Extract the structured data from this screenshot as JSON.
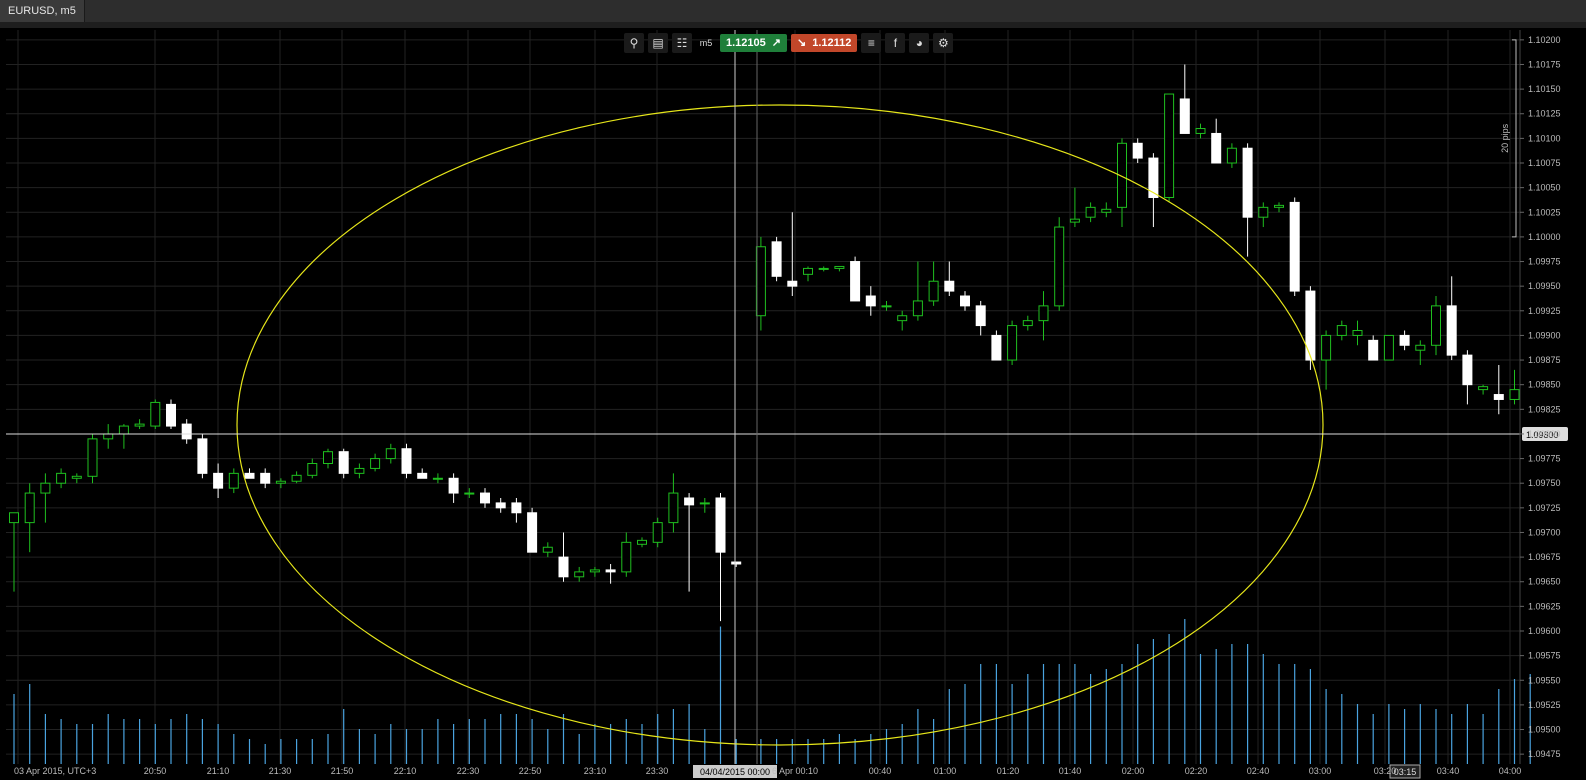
{
  "window": {
    "tab_label": "EURUSD, m5"
  },
  "toolbar": {
    "icons": [
      "search-icon",
      "chart-settings-icon",
      "candles-icon"
    ],
    "timeframe": "m5",
    "buy_price": "1.12105",
    "sell_price": "1.12112",
    "right_icons": [
      "list-icon",
      "facebook-icon",
      "share-icon",
      "tools-icon"
    ]
  },
  "colors": {
    "up_candle": "#1fbf1f",
    "down_candle": "#ffffff",
    "volume": "#4aa3df",
    "ellipse": "#e6e61a",
    "grid": "#222222",
    "background": "#000000"
  },
  "chart_data": {
    "type": "candlestick",
    "symbol": "EURUSD",
    "timeframe": "m5",
    "y_ticks": [
      "1.10200",
      "1.10175",
      "1.10150",
      "1.10125",
      "1.10100",
      "1.10075",
      "1.10050",
      "1.10025",
      "1.10000",
      "1.09975",
      "1.09950",
      "1.09925",
      "1.09900",
      "1.09875",
      "1.09850",
      "1.09825",
      "1.09800",
      "1.09775",
      "1.09750",
      "1.09725",
      "1.09700",
      "1.09675",
      "1.09650",
      "1.09625",
      "1.09600",
      "1.09575",
      "1.09550",
      "1.09525",
      "1.09500",
      "1.09475"
    ],
    "ylim": [
      1.09465,
      1.1021
    ],
    "x_labels": [
      "03 Apr 2015, UTC+3",
      "20:50",
      "21:10",
      "21:30",
      "21:50",
      "22:10",
      "22:30",
      "22:50",
      "23:10",
      "23:30",
      "04/04/2015 00:00",
      "6 Apr 00:10",
      "00:40",
      "01:00",
      "01:20",
      "01:40",
      "02:00",
      "02:20",
      "02:40",
      "03:00",
      "03:20",
      "03:15",
      "03:40",
      "04:00"
    ],
    "crosshair_price": "1.09800",
    "crosshair_time": "04/04/2015 00:00",
    "scale_label": "20 pips",
    "time_marker": "03:15",
    "candles": [
      {
        "o": 1.0971,
        "h": 1.0972,
        "l": 1.0964,
        "c": 1.0972
      },
      {
        "o": 1.0971,
        "h": 1.0975,
        "l": 1.0968,
        "c": 1.0974
      },
      {
        "o": 1.0974,
        "h": 1.0976,
        "l": 1.0971,
        "c": 1.0975
      },
      {
        "o": 1.0975,
        "h": 1.09765,
        "l": 1.09745,
        "c": 1.0976
      },
      {
        "o": 1.09755,
        "h": 1.0976,
        "l": 1.0975,
        "c": 1.09757
      },
      {
        "o": 1.09757,
        "h": 1.098,
        "l": 1.0975,
        "c": 1.09795
      },
      {
        "o": 1.09795,
        "h": 1.0981,
        "l": 1.09785,
        "c": 1.098
      },
      {
        "o": 1.098,
        "h": 1.0981,
        "l": 1.09785,
        "c": 1.09808
      },
      {
        "o": 1.09808,
        "h": 1.09815,
        "l": 1.09805,
        "c": 1.0981
      },
      {
        "o": 1.09808,
        "h": 1.09835,
        "l": 1.09805,
        "c": 1.09832
      },
      {
        "o": 1.0983,
        "h": 1.09835,
        "l": 1.09805,
        "c": 1.09808
      },
      {
        "o": 1.0981,
        "h": 1.09815,
        "l": 1.0979,
        "c": 1.09795
      },
      {
        "o": 1.09795,
        "h": 1.098,
        "l": 1.09755,
        "c": 1.0976
      },
      {
        "o": 1.0976,
        "h": 1.0977,
        "l": 1.09735,
        "c": 1.09745
      },
      {
        "o": 1.09745,
        "h": 1.09765,
        "l": 1.0974,
        "c": 1.0976
      },
      {
        "o": 1.0976,
        "h": 1.09765,
        "l": 1.09755,
        "c": 1.09755
      },
      {
        "o": 1.0976,
        "h": 1.09765,
        "l": 1.09745,
        "c": 1.0975
      },
      {
        "o": 1.0975,
        "h": 1.09755,
        "l": 1.09745,
        "c": 1.09752
      },
      {
        "o": 1.09752,
        "h": 1.09762,
        "l": 1.0975,
        "c": 1.09758
      },
      {
        "o": 1.09758,
        "h": 1.09775,
        "l": 1.09755,
        "c": 1.0977
      },
      {
        "o": 1.0977,
        "h": 1.09785,
        "l": 1.09765,
        "c": 1.09782
      },
      {
        "o": 1.09782,
        "h": 1.09785,
        "l": 1.09755,
        "c": 1.0976
      },
      {
        "o": 1.0976,
        "h": 1.0977,
        "l": 1.09755,
        "c": 1.09765
      },
      {
        "o": 1.09765,
        "h": 1.0978,
        "l": 1.09762,
        "c": 1.09775
      },
      {
        "o": 1.09775,
        "h": 1.0979,
        "l": 1.0977,
        "c": 1.09785
      },
      {
        "o": 1.09785,
        "h": 1.0979,
        "l": 1.09755,
        "c": 1.0976
      },
      {
        "o": 1.0976,
        "h": 1.09765,
        "l": 1.09755,
        "c": 1.09755
      },
      {
        "o": 1.09755,
        "h": 1.0976,
        "l": 1.0975,
        "c": 1.09755
      },
      {
        "o": 1.09755,
        "h": 1.0976,
        "l": 1.0973,
        "c": 1.0974
      },
      {
        "o": 1.0974,
        "h": 1.09745,
        "l": 1.09735,
        "c": 1.0974
      },
      {
        "o": 1.0974,
        "h": 1.09745,
        "l": 1.09725,
        "c": 1.0973
      },
      {
        "o": 1.0973,
        "h": 1.09735,
        "l": 1.0972,
        "c": 1.09725
      },
      {
        "o": 1.0973,
        "h": 1.09735,
        "l": 1.0971,
        "c": 1.0972
      },
      {
        "o": 1.0972,
        "h": 1.09725,
        "l": 1.0968,
        "c": 1.0968
      },
      {
        "o": 1.0968,
        "h": 1.0969,
        "l": 1.09675,
        "c": 1.09685
      },
      {
        "o": 1.09675,
        "h": 1.097,
        "l": 1.0965,
        "c": 1.09655
      },
      {
        "o": 1.09655,
        "h": 1.09665,
        "l": 1.0965,
        "c": 1.0966
      },
      {
        "o": 1.0966,
        "h": 1.09665,
        "l": 1.09655,
        "c": 1.09662
      },
      {
        "o": 1.09662,
        "h": 1.09668,
        "l": 1.09648,
        "c": 1.0966
      },
      {
        "o": 1.0966,
        "h": 1.097,
        "l": 1.09655,
        "c": 1.0969
      },
      {
        "o": 1.09688,
        "h": 1.09695,
        "l": 1.09685,
        "c": 1.09692
      },
      {
        "o": 1.0969,
        "h": 1.09715,
        "l": 1.09685,
        "c": 1.0971
      },
      {
        "o": 1.0971,
        "h": 1.0976,
        "l": 1.097,
        "c": 1.0974
      },
      {
        "o": 1.09735,
        "h": 1.0974,
        "l": 1.0964,
        "c": 1.09728
      },
      {
        "o": 1.0973,
        "h": 1.09735,
        "l": 1.0972,
        "c": 1.0973
      },
      {
        "o": 1.09735,
        "h": 1.0974,
        "l": 1.0961,
        "c": 1.0968
      },
      {
        "o": 1.0967,
        "h": 1.0967,
        "l": 1.09665,
        "c": 1.09668
      },
      {
        "o": 1.0992,
        "h": 1.1,
        "l": 1.09905,
        "c": 1.0999
      },
      {
        "o": 1.09995,
        "h": 1.1,
        "l": 1.09955,
        "c": 1.0996
      },
      {
        "o": 1.09955,
        "h": 1.10025,
        "l": 1.0994,
        "c": 1.0995
      },
      {
        "o": 1.09962,
        "h": 1.0997,
        "l": 1.09955,
        "c": 1.09968
      },
      {
        "o": 1.09968,
        "h": 1.0997,
        "l": 1.09965,
        "c": 1.09968
      },
      {
        "o": 1.09968,
        "h": 1.0997,
        "l": 1.09965,
        "c": 1.0997
      },
      {
        "o": 1.09975,
        "h": 1.0998,
        "l": 1.09935,
        "c": 1.09935
      },
      {
        "o": 1.0994,
        "h": 1.0995,
        "l": 1.0992,
        "c": 1.0993
      },
      {
        "o": 1.0993,
        "h": 1.09935,
        "l": 1.09925,
        "c": 1.0993
      },
      {
        "o": 1.09915,
        "h": 1.09925,
        "l": 1.09905,
        "c": 1.0992
      },
      {
        "o": 1.0992,
        "h": 1.09975,
        "l": 1.09915,
        "c": 1.09935
      },
      {
        "o": 1.09935,
        "h": 1.09975,
        "l": 1.0993,
        "c": 1.09955
      },
      {
        "o": 1.09955,
        "h": 1.09975,
        "l": 1.0994,
        "c": 1.09945
      },
      {
        "o": 1.0994,
        "h": 1.09945,
        "l": 1.09925,
        "c": 1.0993
      },
      {
        "o": 1.0993,
        "h": 1.09935,
        "l": 1.099,
        "c": 1.0991
      },
      {
        "o": 1.099,
        "h": 1.09905,
        "l": 1.09875,
        "c": 1.09875
      },
      {
        "o": 1.09875,
        "h": 1.09915,
        "l": 1.0987,
        "c": 1.0991
      },
      {
        "o": 1.0991,
        "h": 1.0992,
        "l": 1.09905,
        "c": 1.09915
      },
      {
        "o": 1.09915,
        "h": 1.09945,
        "l": 1.09895,
        "c": 1.0993
      },
      {
        "o": 1.0993,
        "h": 1.1002,
        "l": 1.09925,
        "c": 1.1001
      },
      {
        "o": 1.10015,
        "h": 1.1005,
        "l": 1.1001,
        "c": 1.10018
      },
      {
        "o": 1.1002,
        "h": 1.10035,
        "l": 1.10015,
        "c": 1.1003
      },
      {
        "o": 1.10025,
        "h": 1.10035,
        "l": 1.1002,
        "c": 1.10028
      },
      {
        "o": 1.1003,
        "h": 1.101,
        "l": 1.1001,
        "c": 1.10095
      },
      {
        "o": 1.10095,
        "h": 1.101,
        "l": 1.10075,
        "c": 1.1008
      },
      {
        "o": 1.1008,
        "h": 1.10085,
        "l": 1.1001,
        "c": 1.1004
      },
      {
        "o": 1.1004,
        "h": 1.10145,
        "l": 1.10035,
        "c": 1.10145
      },
      {
        "o": 1.1014,
        "h": 1.10175,
        "l": 1.10105,
        "c": 1.10105
      },
      {
        "o": 1.10105,
        "h": 1.10115,
        "l": 1.101,
        "c": 1.1011
      },
      {
        "o": 1.10105,
        "h": 1.1012,
        "l": 1.10075,
        "c": 1.10075
      },
      {
        "o": 1.10075,
        "h": 1.10095,
        "l": 1.1007,
        "c": 1.1009
      },
      {
        "o": 1.1009,
        "h": 1.10095,
        "l": 1.0998,
        "c": 1.1002
      },
      {
        "o": 1.1002,
        "h": 1.10035,
        "l": 1.1001,
        "c": 1.1003
      },
      {
        "o": 1.1003,
        "h": 1.10035,
        "l": 1.10025,
        "c": 1.10032
      },
      {
        "o": 1.10035,
        "h": 1.1004,
        "l": 1.0994,
        "c": 1.09945
      },
      {
        "o": 1.09945,
        "h": 1.0995,
        "l": 1.09865,
        "c": 1.09875
      },
      {
        "o": 1.09875,
        "h": 1.09905,
        "l": 1.09845,
        "c": 1.099
      },
      {
        "o": 1.099,
        "h": 1.09915,
        "l": 1.09895,
        "c": 1.0991
      },
      {
        "o": 1.099,
        "h": 1.09915,
        "l": 1.0989,
        "c": 1.09905
      },
      {
        "o": 1.09895,
        "h": 1.099,
        "l": 1.09875,
        "c": 1.09875
      },
      {
        "o": 1.09875,
        "h": 1.099,
        "l": 1.09875,
        "c": 1.099
      },
      {
        "o": 1.099,
        "h": 1.09905,
        "l": 1.09885,
        "c": 1.0989
      },
      {
        "o": 1.09885,
        "h": 1.09895,
        "l": 1.0987,
        "c": 1.0989
      },
      {
        "o": 1.0989,
        "h": 1.0994,
        "l": 1.0988,
        "c": 1.0993
      },
      {
        "o": 1.0993,
        "h": 1.0996,
        "l": 1.09875,
        "c": 1.0988
      },
      {
        "o": 1.0988,
        "h": 1.09885,
        "l": 1.0983,
        "c": 1.0985
      },
      {
        "o": 1.09845,
        "h": 1.0985,
        "l": 1.0984,
        "c": 1.09848
      },
      {
        "o": 1.0984,
        "h": 1.0987,
        "l": 1.0982,
        "c": 1.09835
      },
      {
        "o": 1.09835,
        "h": 1.09865,
        "l": 1.0983,
        "c": 1.09845
      }
    ],
    "volumes": [
      28,
      32,
      20,
      18,
      16,
      16,
      20,
      18,
      18,
      16,
      18,
      20,
      18,
      16,
      12,
      10,
      8,
      10,
      10,
      10,
      12,
      22,
      14,
      12,
      16,
      14,
      14,
      18,
      16,
      18,
      18,
      20,
      20,
      18,
      14,
      20,
      12,
      16,
      16,
      18,
      16,
      20,
      22,
      24,
      14,
      55,
      10,
      10,
      10,
      10,
      10,
      10,
      12,
      10,
      12,
      14,
      16,
      22,
      18,
      30,
      32,
      40,
      40,
      32,
      36,
      40,
      40,
      40,
      36,
      38,
      40,
      48,
      50,
      52,
      58,
      44,
      46,
      48,
      48,
      44,
      40,
      40,
      38,
      30,
      28,
      24,
      20,
      24,
      22,
      24,
      22,
      20,
      24,
      20,
      30,
      34,
      36
    ]
  }
}
